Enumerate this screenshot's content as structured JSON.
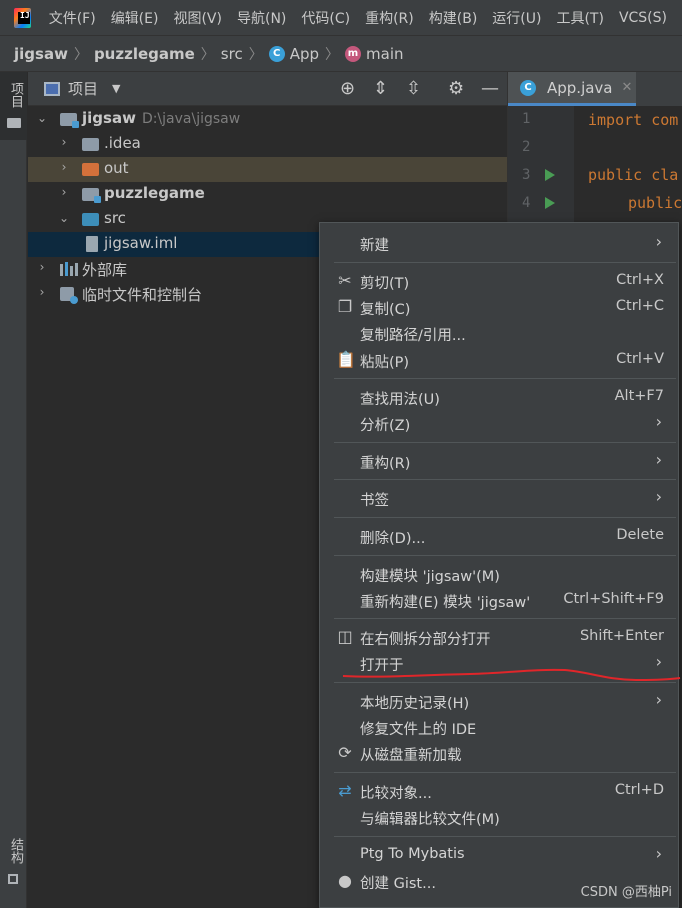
{
  "menubar": {
    "items": [
      "文件(F)",
      "编辑(E)",
      "视图(V)",
      "导航(N)",
      "代码(C)",
      "重构(R)",
      "构建(B)",
      "运行(U)",
      "工具(T)",
      "VCS(S)"
    ]
  },
  "breadcrumb": {
    "items": [
      "jigsaw",
      "puzzlegame",
      "src",
      "App",
      "main"
    ]
  },
  "left_strip": {
    "project_tab": "项目",
    "structure_tab": "结构"
  },
  "project_panel": {
    "title": "项目"
  },
  "tree": {
    "root_name": "jigsaw",
    "root_path": "D:\\java\\jigsaw",
    "idea": ".idea",
    "out": "out",
    "puzzlegame": "puzzlegame",
    "src": "src",
    "iml": "jigsaw.iml",
    "external_libs": "外部库",
    "scratches": "临时文件和控制台"
  },
  "editor": {
    "tab_label": "App.java",
    "lines": [
      "1",
      "2",
      "3",
      "4"
    ],
    "code1": "import com",
    "code3_kw": "public cla",
    "code4_kw": "public"
  },
  "context_menu": {
    "new": "新建",
    "cut": "剪切(T)",
    "cut_sc": "Ctrl+X",
    "copy": "复制(C)",
    "copy_sc": "Ctrl+C",
    "copy_path": "复制路径/引用...",
    "paste": "粘贴(P)",
    "paste_sc": "Ctrl+V",
    "find_usages": "查找用法(U)",
    "find_usages_sc": "Alt+F7",
    "analyze": "分析(Z)",
    "refactor": "重构(R)",
    "bookmarks": "书签",
    "delete": "删除(D)...",
    "delete_sc": "Delete",
    "build_module": "构建模块 'jigsaw'(M)",
    "rebuild_module": "重新构建(E) 模块 'jigsaw'",
    "rebuild_sc": "Ctrl+Shift+F9",
    "open_split": "在右侧拆分部分打开",
    "open_split_sc": "Shift+Enter",
    "open_in": "打开于",
    "local_history": "本地历史记录(H)",
    "repair_ide": "修复文件上的 IDE",
    "reload_disk": "从磁盘重新加载",
    "compare_with": "比较对象...",
    "compare_sc": "Ctrl+D",
    "compare_editor": "与编辑器比较文件(M)",
    "ptg_mybatis": "Ptg To Mybatis",
    "create_gist": "创建 Gist..."
  },
  "watermark": "CSDN @西柚Pi",
  "colors": {
    "background": "#2b2b2b",
    "panel": "#3c3f41",
    "selection": "#0d293e",
    "accent": "#4a88c7",
    "annotation": "#e0262a"
  }
}
